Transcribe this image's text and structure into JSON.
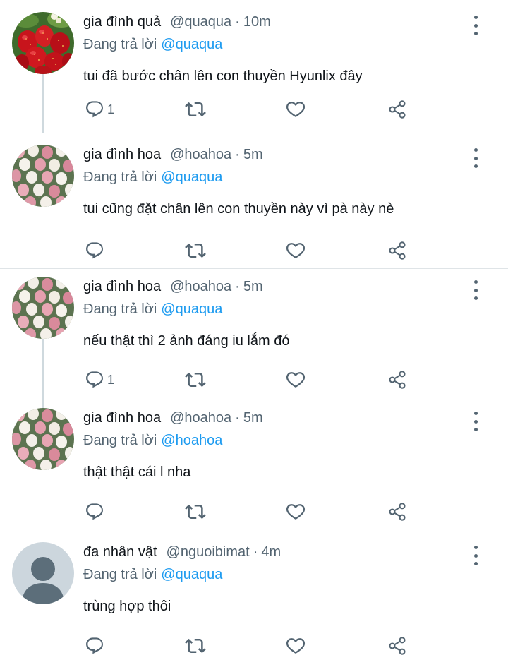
{
  "tweets": [
    {
      "name": "gia đình quả",
      "handle": "@quaqua",
      "time": "10m",
      "reply_prefix": "Đang trả lời",
      "reply_target": "@quaqua",
      "text": "tui đã bước chân lên con thuyền Hyunlix đây",
      "reply_count": "1",
      "avatar_icon": "strawberry-avatar"
    },
    {
      "name": "gia đình hoa",
      "handle": "@hoahoa",
      "time": "5m",
      "reply_prefix": "Đang trả lời",
      "reply_target": "@quaqua",
      "text": "tui cũng đặt chân lên con thuyền này vì pà này nè",
      "reply_count": "",
      "avatar_icon": "tulip-field-avatar"
    },
    {
      "name": "gia đình hoa",
      "handle": "@hoahoa",
      "time": "5m",
      "reply_prefix": "Đang trả lời",
      "reply_target": "@quaqua",
      "text": "nếu thật thì 2 ảnh đáng iu lắm đó",
      "reply_count": "1",
      "avatar_icon": "tulip-field-avatar"
    },
    {
      "name": "gia đình hoa",
      "handle": "@hoahoa",
      "time": "5m",
      "reply_prefix": "Đang trả lời",
      "reply_target": "@hoahoa",
      "text": "thật thật cái l nha",
      "reply_count": "",
      "avatar_icon": "tulip-field-avatar"
    },
    {
      "name": "đa nhân vật",
      "handle": "@nguoibimat",
      "time": "4m",
      "reply_prefix": "Đang trả lời",
      "reply_target": "@quaqua",
      "text": "trùng hợp thôi",
      "reply_count": "",
      "avatar_icon": "default-user-avatar"
    }
  ],
  "separator": "·",
  "colors": {
    "link": "#1d9bf0",
    "secondary_text": "#536471",
    "thread_line": "#cfd9de",
    "divider": "#dfe4e7"
  }
}
